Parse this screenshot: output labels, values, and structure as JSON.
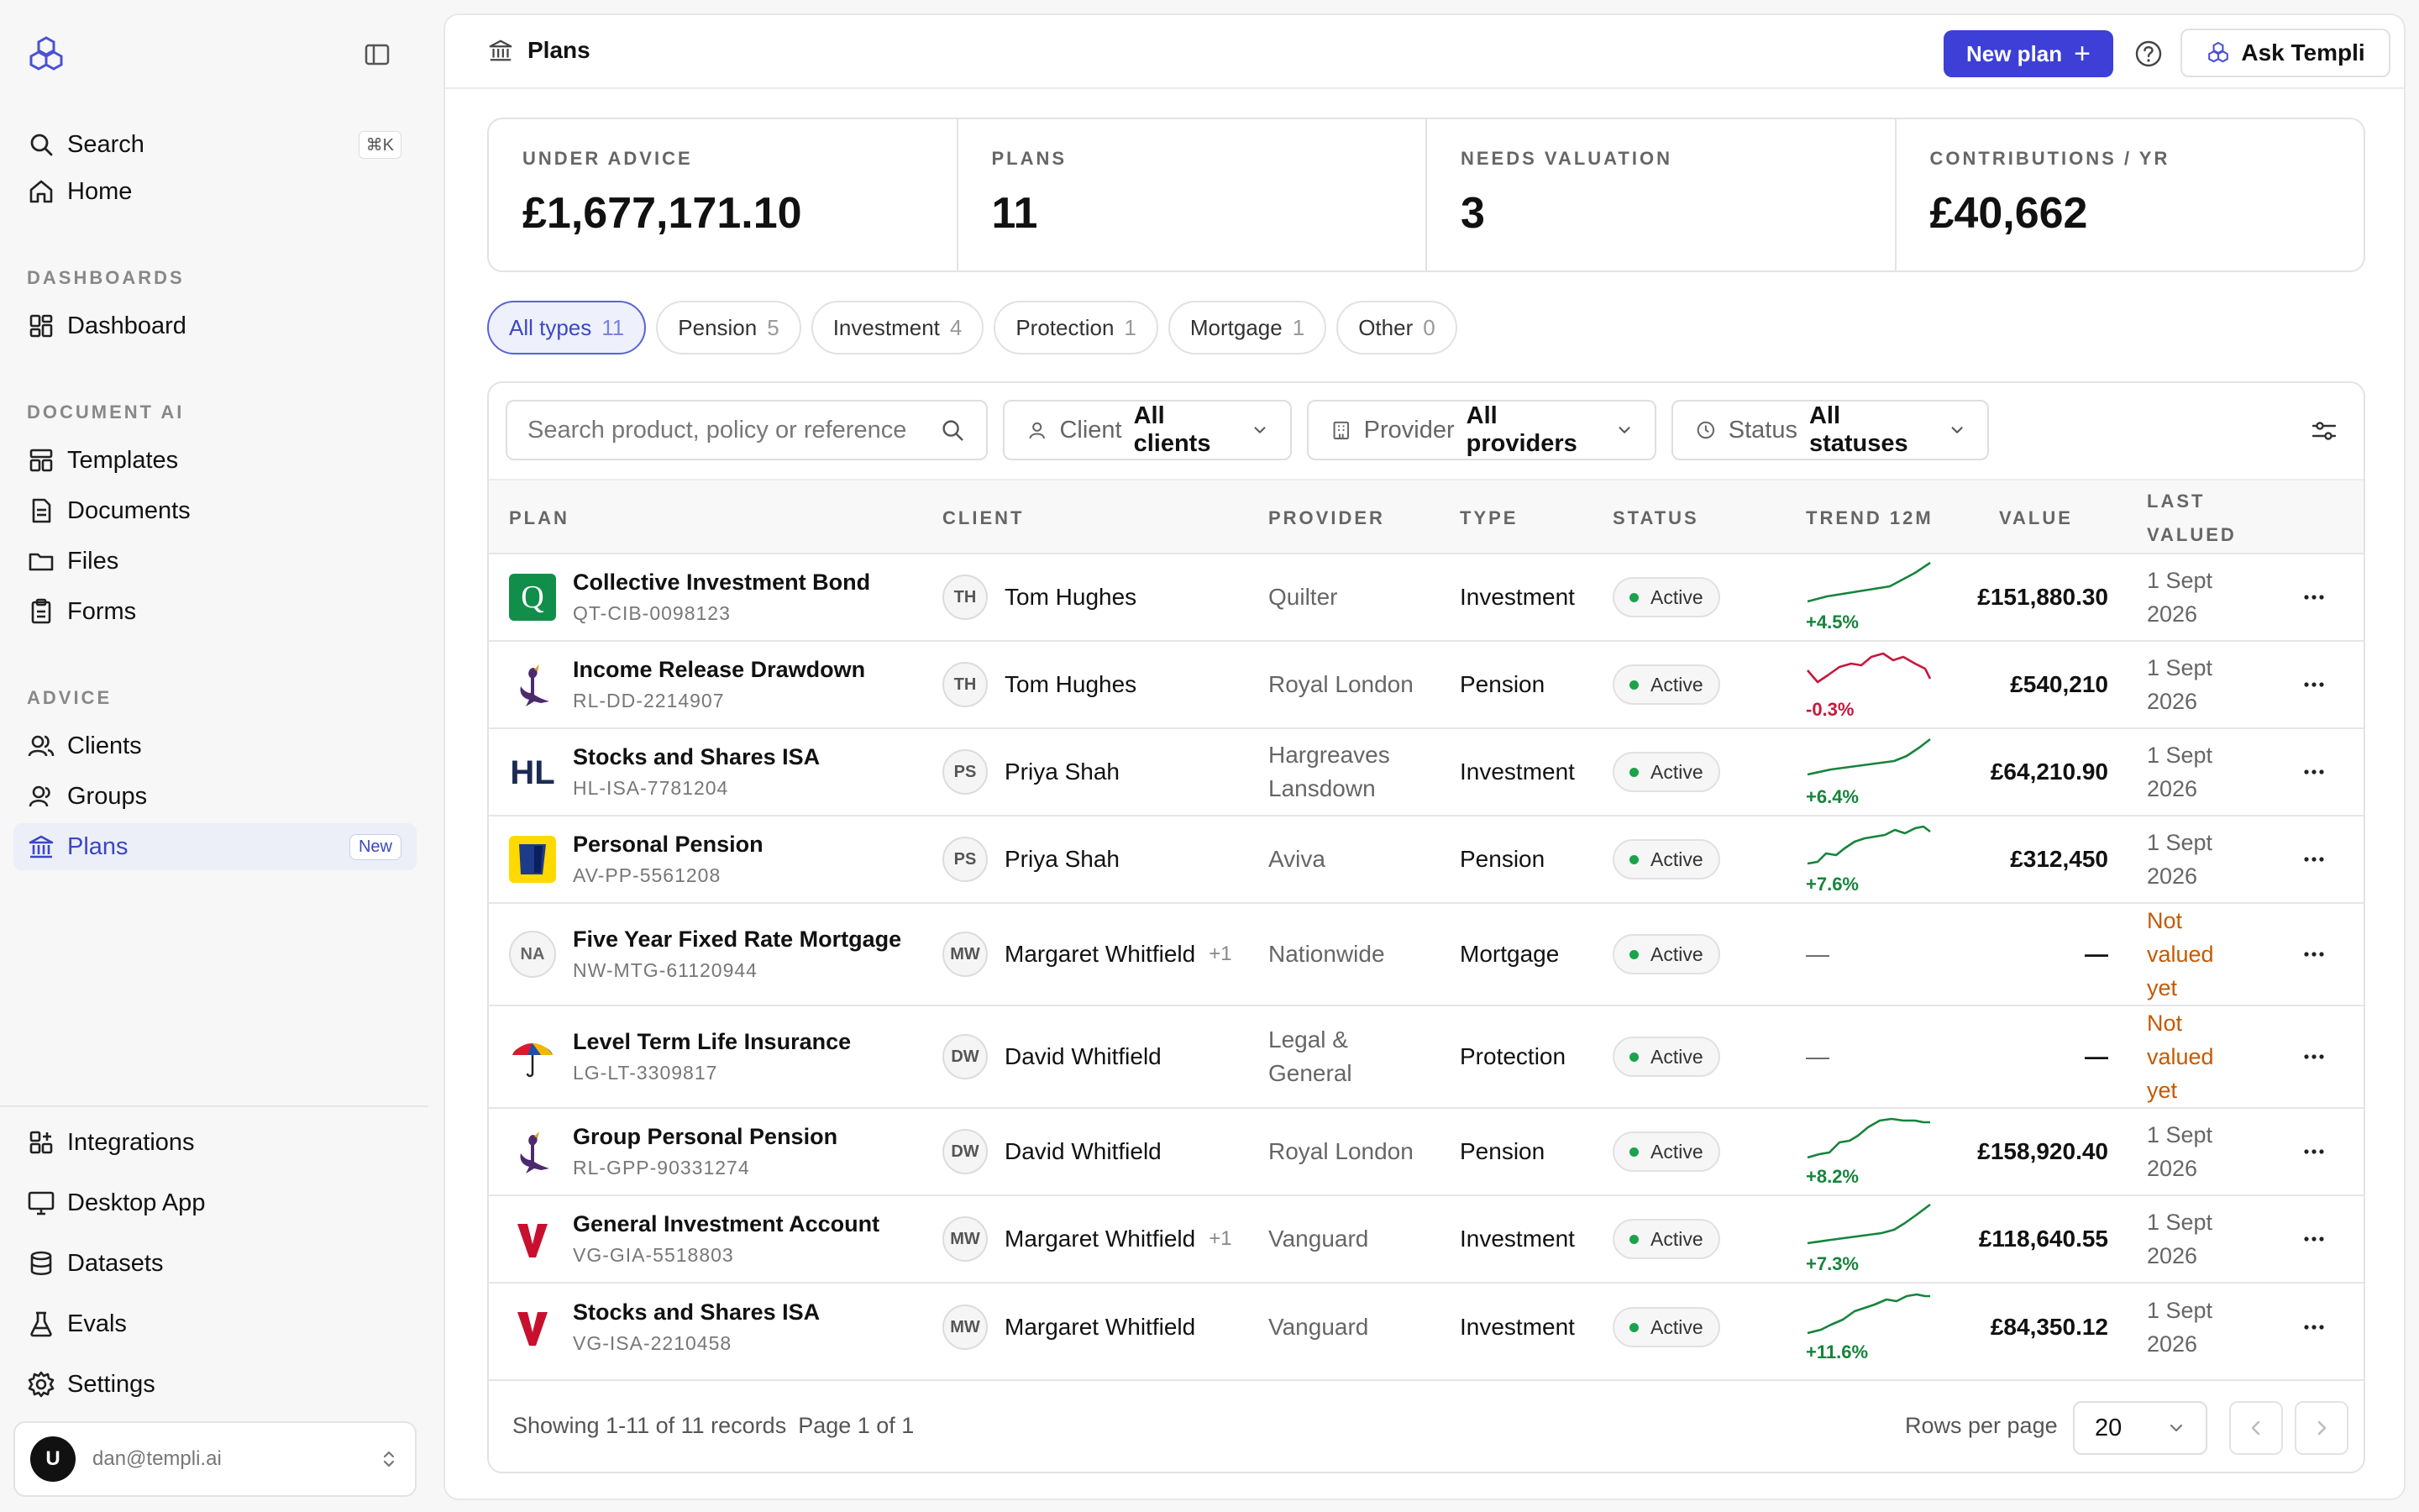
{
  "sidebar": {
    "search_label": "Search",
    "search_shortcut": "⌘K",
    "home_label": "Home",
    "sections": {
      "dashboards": "DASHBOARDS",
      "document_ai": "DOCUMENT AI",
      "advice": "ADVICE"
    },
    "dashboard_label": "Dashboard",
    "templates_label": "Templates",
    "documents_label": "Documents",
    "files_label": "Files",
    "forms_label": "Forms",
    "clients_label": "Clients",
    "groups_label": "Groups",
    "plans_label": "Plans",
    "plans_badge": "New",
    "integrations_label": "Integrations",
    "desktop_label": "Desktop App",
    "datasets_label": "Datasets",
    "evals_label": "Evals",
    "settings_label": "Settings",
    "user": {
      "initial": "U",
      "email": "dan@templi.ai"
    }
  },
  "header": {
    "title": "Plans",
    "new_plan_label": "New plan",
    "ask_label": "Ask Templi"
  },
  "kpis": [
    {
      "label": "UNDER ADVICE",
      "value": "£1,677,171.10"
    },
    {
      "label": "PLANS",
      "value": "11"
    },
    {
      "label": "NEEDS VALUATION",
      "value": "3"
    },
    {
      "label": "CONTRIBUTIONS / YR",
      "value": "£40,662"
    }
  ],
  "type_filters": [
    {
      "label": "All types",
      "count": "11"
    },
    {
      "label": "Pension",
      "count": "5"
    },
    {
      "label": "Investment",
      "count": "4"
    },
    {
      "label": "Protection",
      "count": "1"
    },
    {
      "label": "Mortgage",
      "count": "1"
    },
    {
      "label": "Other",
      "count": "0"
    }
  ],
  "filters": {
    "search_placeholder": "Search product, policy or reference",
    "client_label": "Client",
    "client_value": "All clients",
    "provider_label": "Provider",
    "provider_value": "All providers",
    "status_label": "Status",
    "status_value": "All statuses"
  },
  "columns": {
    "plan": "PLAN",
    "client": "CLIENT",
    "provider": "PROVIDER",
    "type": "TYPE",
    "status": "STATUS",
    "trend": "TREND 12M",
    "value": "VALUE",
    "last_valued_1": "LAST",
    "last_valued_2": "VALUED"
  },
  "rows": [
    {
      "name": "Collective Investment Bond",
      "ref": "QT-CIB-0098123",
      "initials": "TH",
      "client": "Tom Hughes",
      "extra": "",
      "provider_1": "Quilter",
      "provider_2": "",
      "type": "Investment",
      "status": "Active",
      "trend": "+4.5%",
      "value": "£151,880.30",
      "date_1": "1 Sept",
      "date_2": "2026",
      "date_3": ""
    },
    {
      "name": "Income Release Drawdown",
      "ref": "RL-DD-2214907",
      "initials": "TH",
      "client": "Tom Hughes",
      "extra": "",
      "provider_1": "Royal London",
      "provider_2": "",
      "type": "Pension",
      "status": "Active",
      "trend": "-0.3%",
      "value": "£540,210",
      "date_1": "1 Sept",
      "date_2": "2026",
      "date_3": ""
    },
    {
      "name": "Stocks and Shares ISA",
      "ref": "HL-ISA-7781204",
      "initials": "PS",
      "client": "Priya Shah",
      "extra": "",
      "provider_1": "Hargreaves",
      "provider_2": "Lansdown",
      "type": "Investment",
      "status": "Active",
      "trend": "+6.4%",
      "value": "£64,210.90",
      "date_1": "1 Sept",
      "date_2": "2026",
      "date_3": ""
    },
    {
      "name": "Personal Pension",
      "ref": "AV-PP-5561208",
      "initials": "PS",
      "client": "Priya Shah",
      "extra": "",
      "provider_1": "Aviva",
      "provider_2": "",
      "type": "Pension",
      "status": "Active",
      "trend": "+7.6%",
      "value": "£312,450",
      "date_1": "1 Sept",
      "date_2": "2026",
      "date_3": ""
    },
    {
      "name": "Five Year Fixed Rate Mortgage",
      "ref": "NW-MTG-61120944",
      "logo_text": "NA",
      "initials": "MW",
      "client": "Margaret Whitfield",
      "extra": "+1",
      "provider_1": "Nationwide",
      "provider_2": "",
      "type": "Mortgage",
      "status": "Active",
      "trend": "—",
      "value": "—",
      "date_1": "Not",
      "date_2": "valued",
      "date_3": "yet"
    },
    {
      "name": "Level Term Life Insurance",
      "ref": "LG-LT-3309817",
      "initials": "DW",
      "client": "David Whitfield",
      "extra": "",
      "provider_1": "Legal &",
      "provider_2": "General",
      "type": "Protection",
      "status": "Active",
      "trend": "—",
      "value": "—",
      "date_1": "Not",
      "date_2": "valued",
      "date_3": "yet"
    },
    {
      "name": "Group Personal Pension",
      "ref": "RL-GPP-90331274",
      "initials": "DW",
      "client": "David Whitfield",
      "extra": "",
      "provider_1": "Royal London",
      "provider_2": "",
      "type": "Pension",
      "status": "Active",
      "trend": "+8.2%",
      "value": "£158,920.40",
      "date_1": "1 Sept",
      "date_2": "2026",
      "date_3": ""
    },
    {
      "name": "General Investment Account",
      "ref": "VG-GIA-5518803",
      "initials": "MW",
      "client": "Margaret Whitfield",
      "extra": "+1",
      "provider_1": "Vanguard",
      "provider_2": "",
      "type": "Investment",
      "status": "Active",
      "trend": "+7.3%",
      "value": "£118,640.55",
      "date_1": "1 Sept",
      "date_2": "2026",
      "date_3": ""
    },
    {
      "name": "Stocks and Shares ISA",
      "ref": "VG-ISA-2210458",
      "initials": "MW",
      "client": "Margaret Whitfield",
      "extra": "",
      "provider_1": "Vanguard",
      "provider_2": "",
      "type": "Investment",
      "status": "Active",
      "trend": "+11.6%",
      "value": "£84,350.12",
      "date_1": "1 Sept",
      "date_2": "2026",
      "date_3": ""
    }
  ],
  "footer": {
    "showing": "Showing 1-11 of 11 records",
    "page": "Page 1 of 1",
    "rows_per_page_label": "Rows per page",
    "rows_per_page_value": "20"
  },
  "colors": {
    "primary": "#3d3fd6",
    "active_nav": "#3b47c4",
    "trend_up": "#16843b",
    "trend_down": "#c7173d",
    "warning": "#c45a04"
  }
}
